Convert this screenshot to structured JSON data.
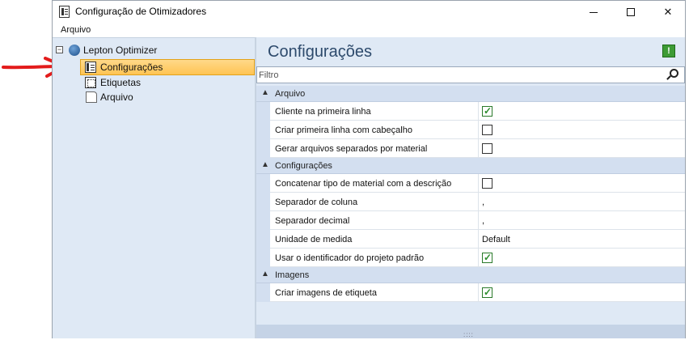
{
  "window": {
    "title": "Configuração de Otimizadores",
    "minimize_glyph": "—",
    "maximize_glyph": "☐",
    "close_glyph": "✕"
  },
  "menu": {
    "items": [
      {
        "label": "Arquivo"
      }
    ]
  },
  "tree": {
    "root": {
      "label": "Lepton Optimizer",
      "expander": "−",
      "icon": "lepton-globe-icon"
    },
    "children": [
      {
        "label": "Configurações",
        "icon": "config-icon",
        "selected": true
      },
      {
        "label": "Etiquetas",
        "icon": "label-icon"
      },
      {
        "label": "Arquivo",
        "icon": "file-icon"
      }
    ]
  },
  "content": {
    "title": "Configurações",
    "info_glyph": "!",
    "filter": {
      "placeholder": "Filtro",
      "value": ""
    },
    "groups": [
      {
        "name": "Arquivo",
        "rows": [
          {
            "label": "Cliente na primeira linha",
            "type": "checkbox",
            "checked": true
          },
          {
            "label": "Criar primeira linha com cabeçalho",
            "type": "checkbox",
            "checked": false
          },
          {
            "label": "Gerar arquivos separados por material",
            "type": "checkbox",
            "checked": false
          }
        ]
      },
      {
        "name": "Configurações",
        "rows": [
          {
            "label": "Concatenar tipo de material com a descrição",
            "type": "checkbox",
            "checked": false
          },
          {
            "label": "Separador de coluna",
            "type": "text",
            "value": ","
          },
          {
            "label": "Separador decimal",
            "type": "text",
            "value": ","
          },
          {
            "label": "Unidade de medida",
            "type": "text",
            "value": "Default"
          },
          {
            "label": "Usar o identificador do projeto padrão",
            "type": "checkbox",
            "checked": true
          }
        ]
      },
      {
        "name": "Imagens",
        "rows": [
          {
            "label": "Criar imagens de etiqueta",
            "type": "checkbox",
            "checked": true
          }
        ]
      }
    ],
    "collapse_glyph": "▲"
  },
  "annotation": {
    "arrow_color": "#e31c1c"
  },
  "colors": {
    "selection": "#ffc453",
    "panel": "#dfe9f5",
    "title_text": "#2d4a6c"
  }
}
